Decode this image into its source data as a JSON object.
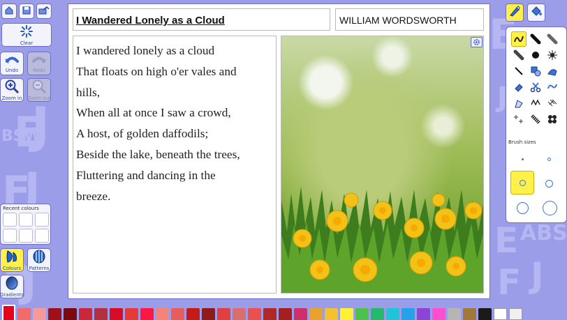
{
  "toolbar": {
    "clear_label": "Clear",
    "undo_label": "Undo",
    "redo_label": "Redo",
    "zoom_in_label": "Zoom in",
    "zoom_out_label": "Zoom out",
    "colours_label": "Colours",
    "patterns_label": "Patterns",
    "gradients_label": "Gradients"
  },
  "recent_colours": {
    "label": "Recent colours"
  },
  "worksheet": {
    "title": "I Wandered Lonely as a Cloud",
    "author": "WILLIAM WORDSWORTH",
    "poem_lines": [
      "I wandered lonely as a cloud",
      "That floats on high o'er vales and",
      "hills,",
      "When all at once I saw a crowd,",
      "A host, of golden daffodils;",
      "Beside the lake, beneath the trees,",
      "Fluttering and dancing in the",
      "breeze."
    ]
  },
  "brushes": {
    "sizes_label": "Brush sizes"
  },
  "icons": [
    "home-icon",
    "save-icon",
    "share-icon",
    "clear-icon",
    "undo-icon",
    "redo-icon",
    "zoom-in-icon",
    "zoom-out-icon",
    "colours-icon",
    "patterns-icon",
    "gradients-icon",
    "brush-tool-icon",
    "fill-tool-icon",
    "settings-icon"
  ],
  "colors": {
    "accent": "#fff04a",
    "swatches": [
      "#e8001c",
      "#f26b6b",
      "#f59a9a",
      "#a01018",
      "#7a0a10",
      "#c8283a",
      "#b23040",
      "#d80c24",
      "#e43a3a",
      "#ff1744",
      "#f5837a",
      "#e85c5c",
      "#c41a1a",
      "#8e1a1a",
      "#e04040",
      "#d86e6e",
      "#ea5050",
      "#b02828",
      "#a42020",
      "#d0306a",
      "#e9a130",
      "#f2c230",
      "#fff234",
      "#4cc24c",
      "#25b86e",
      "#1fc4d8",
      "#26a2ea",
      "#8f44d8",
      "#ff4fd0",
      "#b5b5b5",
      "#a0783a",
      "#1a1a1a",
      "#ffffff",
      "#f0f0f0"
    ]
  }
}
